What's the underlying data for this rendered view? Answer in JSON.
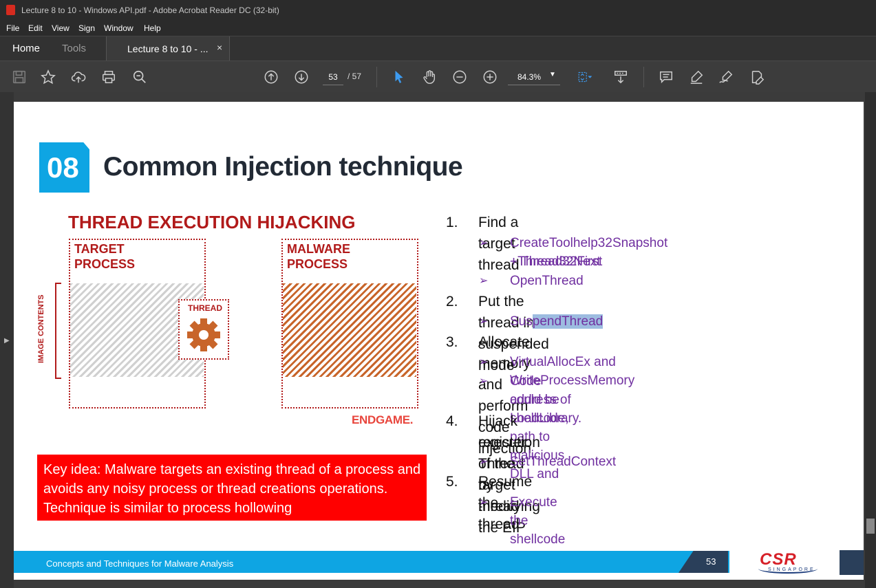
{
  "window": {
    "title": "Lecture 8 to 10 - Windows API.pdf - Adobe Acrobat Reader DC (32-bit)"
  },
  "menu": [
    "File",
    "Edit",
    "View",
    "Sign",
    "Window",
    "Help"
  ],
  "tabs": {
    "home": "Home",
    "tools": "Tools",
    "document": "Lecture 8 to 10 - ...",
    "close": "×"
  },
  "toolbar": {
    "page_current": "53",
    "page_total": "/ 57",
    "zoom": "84.3%",
    "icons": [
      "save-icon",
      "bookmark-star-icon",
      "upload-icon",
      "print-icon",
      "search-zoom-icon",
      "page-up-icon",
      "page-down-icon",
      "select-cursor-icon",
      "hand-icon",
      "zoom-out-icon",
      "zoom-in-icon",
      "fit-page-icon",
      "scroll-mode-icon",
      "comment-icon",
      "highlight-pen-icon",
      "sign-icon",
      "edit-tools-icon"
    ]
  },
  "slide": {
    "badge": "08",
    "title": "Common Injection technique",
    "diagram": {
      "title": "THREAD EXECUTION HIJACKING",
      "target_line1": "TARGET",
      "target_line2": "PROCESS",
      "malware_line1": "MALWARE",
      "malware_line2": "PROCESS",
      "thread": "THREAD",
      "image_contents": "IMAGE CONTENTS",
      "brand": "ENDGAME."
    },
    "key_idea": "Key idea: Malware targets an existing thread of a process and avoids any noisy process or thread creations operations. Technique is similar to process hollowing",
    "steps": [
      {
        "num": "1.",
        "text": "Find a target thread",
        "subs": [
          "CreateToolhelp32Snapshot + Thread32First",
          "+Thread32Next",
          "OpenThread"
        ]
      },
      {
        "num": "2.",
        "text": "Put the thread into suspended mode",
        "subs_pre": "Sus",
        "subs_hl": "pendThread"
      },
      {
        "num": "3.",
        "text": "Allocate memory and perform code injection",
        "subs": [
          "VirtualAllocEx and WriteProcessMemory",
          "Code could be shellcode, path to malicious DLL and",
          "address of LoadLibrary."
        ]
      },
      {
        "num": "4.",
        "text": "Hijack execution Thread by modifying the EIP",
        "text2": "register of the target thread",
        "subs": [
          "SetThreadContext"
        ]
      },
      {
        "num": "5.",
        "text": "Resume the thread",
        "subs": [
          "Execute the shellcode"
        ]
      }
    ],
    "bullet": "➢",
    "footer": "Concepts and Techniques for Malware Analysis",
    "page_number": "53",
    "logo_main": "CSR",
    "logo_sub": "SINGAPORE"
  }
}
